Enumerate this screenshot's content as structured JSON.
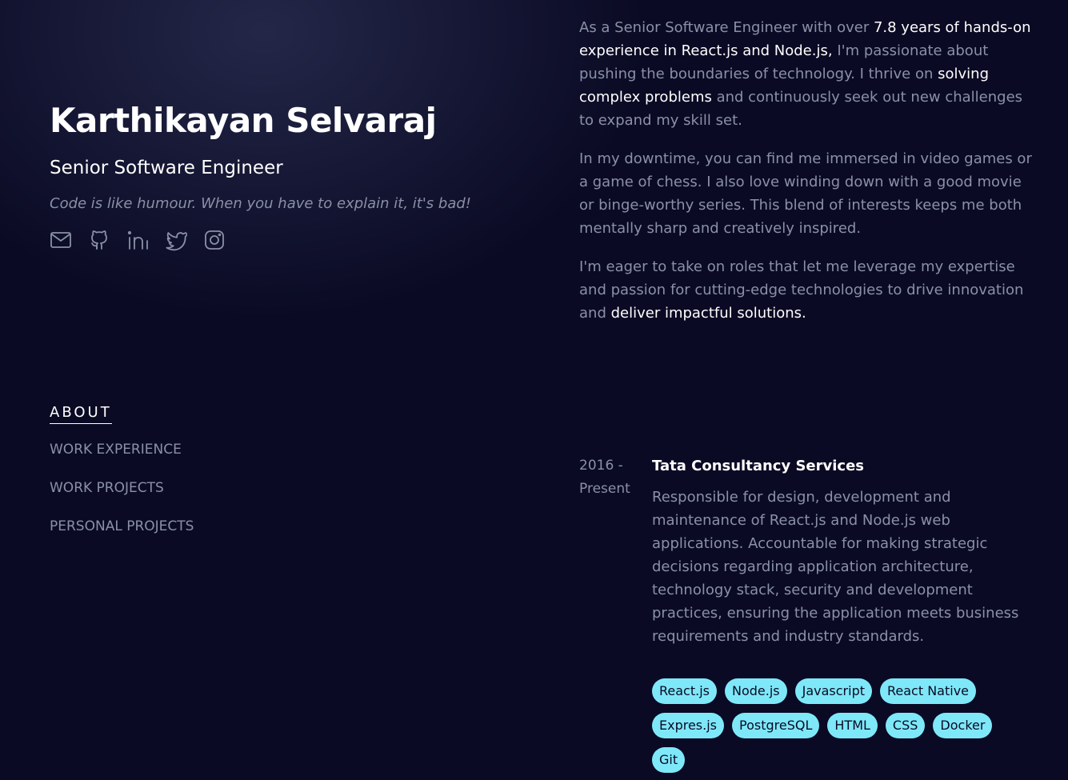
{
  "profile": {
    "name": "Karthikayan Selvaraj",
    "role": "Senior Software Engineer",
    "quote": "Code is like humour. When you have to explain it, it's bad!"
  },
  "socials": [
    "mail-icon",
    "github-icon",
    "linkedin-icon",
    "twitter-icon",
    "instagram-icon"
  ],
  "nav": {
    "about": "ABOUT",
    "work_experience": "WORK EXPERIENCE",
    "work_projects": "WORK PROJECTS",
    "personal_projects": "PERSONAL PROJECTS"
  },
  "about": {
    "p1_a": "As a Senior Software Engineer with over ",
    "p1_b": "7.8 years of hands-on experience in React.js and Node.js,",
    "p1_c": " I'm passionate about pushing the boundaries of technology. I thrive on ",
    "p1_d": "solving complex problems",
    "p1_e": " and continuously seek out new challenges to expand my skill set.",
    "p2": "In my downtime, you can find me immersed in video games or a game of chess. I also love winding down with a good movie or binge-worthy series. This blend of interests keeps me both mentally sharp and creatively inspired.",
    "p3_a": "I'm eager to take on roles that let me leverage my expertise and passion for cutting-edge technologies to drive innovation and ",
    "p3_b": "deliver impactful solutions."
  },
  "experience": {
    "date": "2016 - Present",
    "company": "Tata Consultancy Services",
    "description": "Responsible for design, development and maintenance of React.js and Node.js web applications. Accountable for making strategic decisions regarding application architecture, technology stack, security and development practices, ensuring the application meets business requirements and industry standards.",
    "tags": [
      "React.js",
      "Node.js",
      "Javascript",
      "React Native",
      "Expres.js",
      "PostgreSQL",
      "HTML",
      "CSS",
      "Docker",
      "Git"
    ]
  },
  "colors": {
    "background": "#0a0a24",
    "text_muted": "#8a90a6",
    "text_bright": "#ffffff",
    "tag_bg": "#7ee8f8"
  }
}
